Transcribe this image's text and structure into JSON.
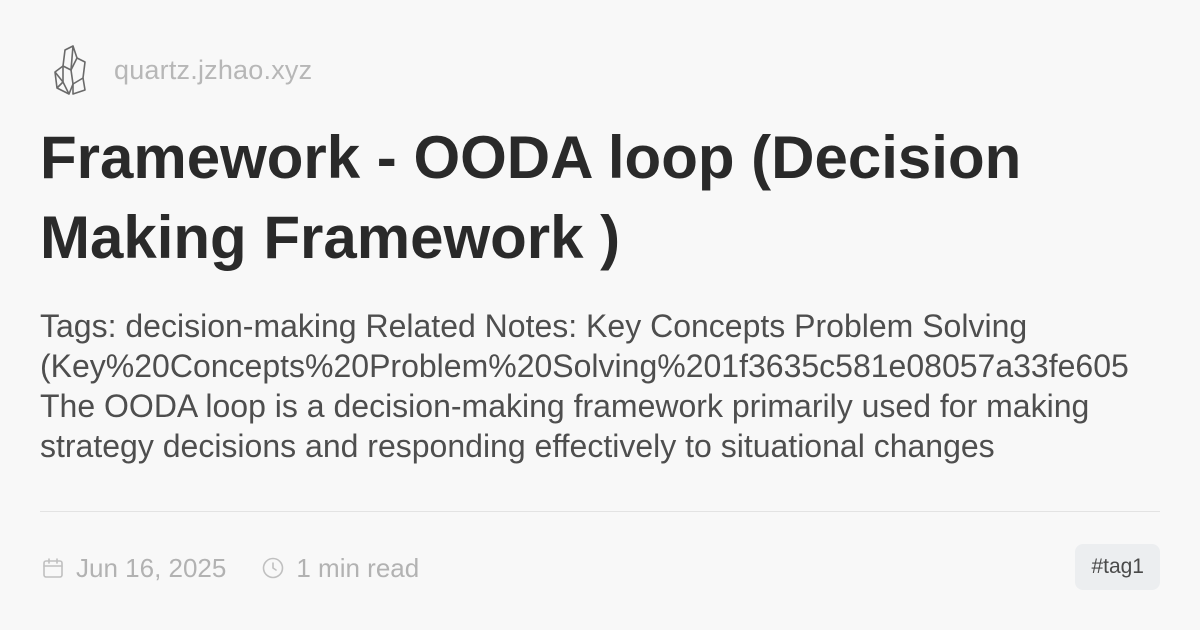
{
  "header": {
    "logo_icon": "crystal-logo-icon",
    "site_name": "quartz.jzhao.xyz"
  },
  "post": {
    "title": "Framework - OODA loop (Decision Making Framework )",
    "excerpt_lines": [
      "Tags: decision-making Related Notes: Key Concepts Problem Solving",
      "(Key%20Concepts%20Problem%20Solving%201f3635c581e08057a33fe605",
      "The OODA loop is a decision-making framework primarily used for making",
      "strategy decisions and responding effectively to situational changes"
    ]
  },
  "meta": {
    "date_icon": "calendar-icon",
    "date": "Jun 16, 2025",
    "read_icon": "clock-icon",
    "reading_time": "1 min read"
  },
  "tags": [
    "#tag1"
  ],
  "colors": {
    "background": "#f8f8f8",
    "title": "#2a2a2a",
    "muted": "#b2b2b2",
    "tag_bg": "#eceef0"
  }
}
